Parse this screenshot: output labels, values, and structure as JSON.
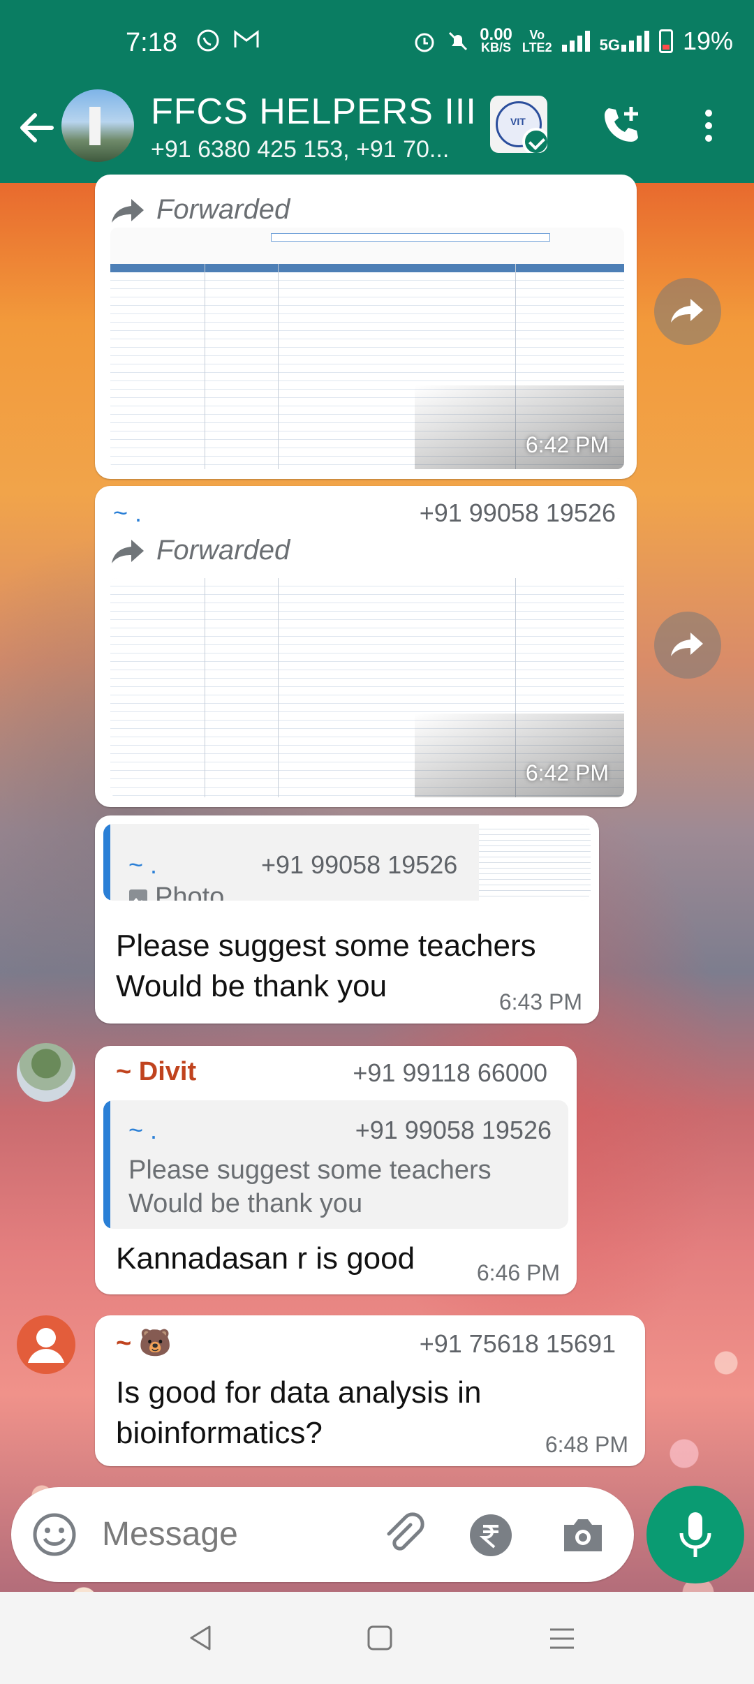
{
  "status_bar": {
    "time": "7:18",
    "net_speed_top": "0.00",
    "net_speed_unit": "KB/S",
    "volte_top": "Vo",
    "volte_bottom": "LTE2",
    "network": "5G",
    "battery": "19%"
  },
  "header": {
    "title": "FFCS HELPERS III",
    "participants": "+91 6380 425 153, +91 70..."
  },
  "messages": [
    {
      "type": "forwarded_image",
      "forwarded_label": "Forwarded",
      "time": "6:42 PM"
    },
    {
      "type": "forwarded_image",
      "sender": "~ .",
      "phone": "+91 99058 19526",
      "forwarded_label": "Forwarded",
      "time": "6:42 PM"
    },
    {
      "type": "reply",
      "quote_sender": "~ .",
      "quote_phone": "+91 99058 19526",
      "quote_kind": "Photo",
      "text_line1": "Please suggest some teachers",
      "text_line2": "Would be thank you",
      "time": "6:43 PM"
    },
    {
      "type": "reply",
      "sender": "~ Divit",
      "phone": "+91 99118 66000",
      "quote_sender": "~ .",
      "quote_phone": "+91 99058 19526",
      "quote_line1": "Please suggest some teachers",
      "quote_line2": "Would be thank you",
      "text": "Kannadasan r is good",
      "time": "6:46 PM"
    },
    {
      "type": "text",
      "sender": "~ 🐻",
      "phone": "+91 75618 15691",
      "text_line1": "Is good for data analysis in",
      "text_line2": "bioinformatics?",
      "time": "6:48 PM"
    }
  ],
  "composer": {
    "placeholder": "Message"
  },
  "colors": {
    "brand": "#0a7d62",
    "mic": "#0a9b72",
    "sender_divit": "#c0431e",
    "tilde_blue": "#2a7fd6"
  },
  "icons": [
    "back-arrow-icon",
    "add-call-icon",
    "more-options-icon",
    "forward-icon",
    "emoji-icon",
    "attach-icon",
    "rupee-icon",
    "camera-icon",
    "mic-icon",
    "nav-back-icon",
    "nav-home-icon",
    "nav-menu-icon"
  ]
}
